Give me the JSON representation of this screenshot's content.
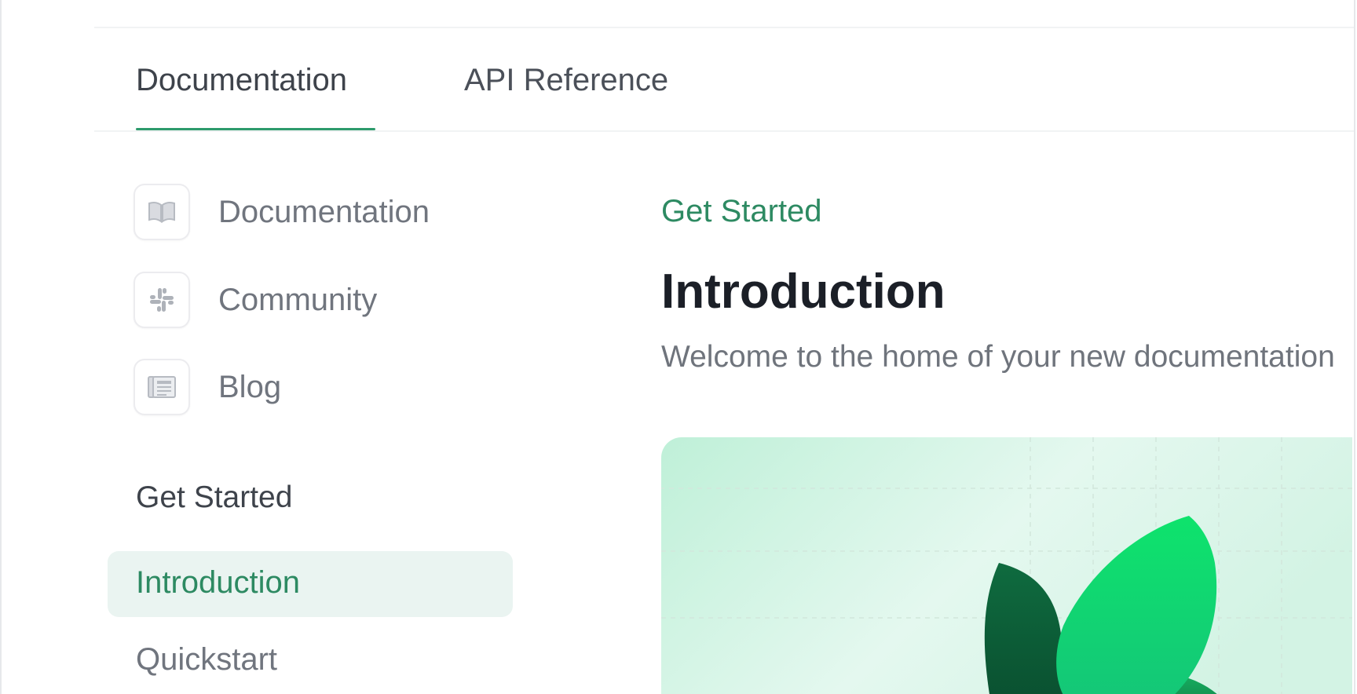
{
  "tabs": [
    {
      "label": "Documentation"
    },
    {
      "label": "API Reference"
    }
  ],
  "sidebar": {
    "links": [
      {
        "label": "Documentation",
        "icon": "book-icon"
      },
      {
        "label": "Community",
        "icon": "slack-icon"
      },
      {
        "label": "Blog",
        "icon": "newspaper-icon"
      }
    ],
    "section_title": "Get Started",
    "nav": [
      {
        "label": "Introduction",
        "active": true
      },
      {
        "label": "Quickstart",
        "active": false
      }
    ]
  },
  "main": {
    "eyebrow": "Get Started",
    "title": "Introduction",
    "description": "Welcome to the home of your new documentation"
  },
  "colors": {
    "accent": "#2d8a62",
    "active_bg": "#eaf4f1",
    "hero_bg": "#c9f1de"
  }
}
